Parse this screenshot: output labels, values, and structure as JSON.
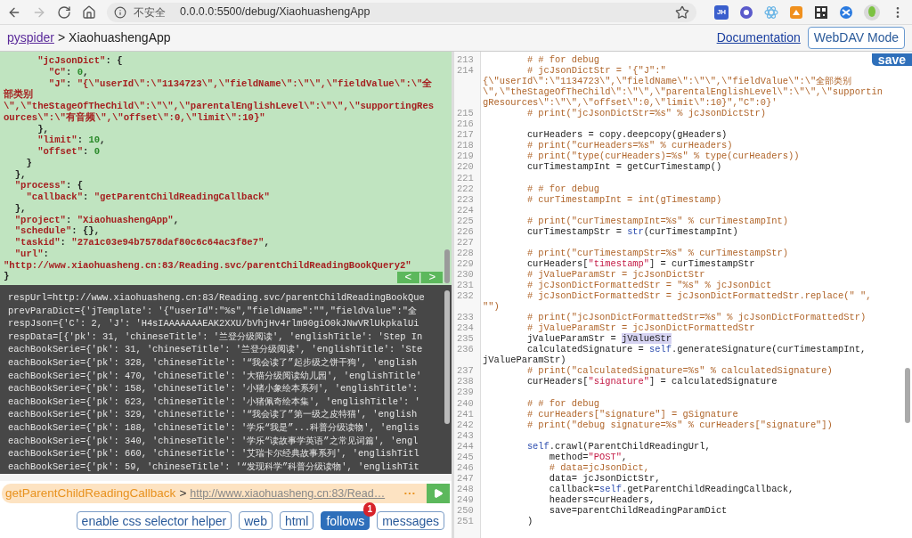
{
  "browser": {
    "forward_disabled": true,
    "security_label": "不安全",
    "url": "0.0.0.0:5500/debug/XiaohuashengApp",
    "extension_label": "JH"
  },
  "header": {
    "root_link": "pyspider",
    "separator": ">",
    "project": "XiaohuashengApp",
    "documentation_link": "Documentation",
    "mode_button": "WebDAV Mode"
  },
  "task_json": {
    "lines": [
      [
        {
          "kind": "string",
          "text": "      \"jcJsonDict\""
        },
        {
          "kind": "punct",
          "text": ": {"
        }
      ],
      [
        {
          "kind": "string",
          "text": "        \"C\""
        },
        {
          "kind": "punct",
          "text": ": "
        },
        {
          "kind": "number",
          "text": "0"
        },
        {
          "kind": "punct",
          "text": ","
        }
      ],
      [
        {
          "kind": "string",
          "text": "        \"J\""
        },
        {
          "kind": "punct",
          "text": ": "
        },
        {
          "kind": "string",
          "text": "\"{\\\"userId\\\":\\\"1134723\\\",\\\"fieldName\\\":\\\"\\\",\\\"fieldValue\\\":\\\"全"
        }
      ],
      [
        {
          "kind": "string",
          "text": "部类别"
        }
      ],
      [
        {
          "kind": "string",
          "text": "\\\",\\\"theStageOfTheChild\\\":\\\"\\\",\\\"parentalEnglishLevel\\\":\\\"\\\",\\\"supportingRes"
        }
      ],
      [
        {
          "kind": "string",
          "text": "ources\\\":\\\"有音频\\\",\\\"offset\\\":0,\\\"limit\\\":10}\""
        }
      ],
      [
        {
          "kind": "punct",
          "text": "      },"
        }
      ],
      [
        {
          "kind": "string",
          "text": "      \"limit\""
        },
        {
          "kind": "punct",
          "text": ": "
        },
        {
          "kind": "number",
          "text": "10"
        },
        {
          "kind": "punct",
          "text": ","
        }
      ],
      [
        {
          "kind": "string",
          "text": "      \"offset\""
        },
        {
          "kind": "punct",
          "text": ": "
        },
        {
          "kind": "number",
          "text": "0"
        }
      ],
      [
        {
          "kind": "punct",
          "text": "    }"
        }
      ],
      [
        {
          "kind": "punct",
          "text": "  },"
        }
      ],
      [
        {
          "kind": "string",
          "text": "  \"process\""
        },
        {
          "kind": "punct",
          "text": ": {"
        }
      ],
      [
        {
          "kind": "string",
          "text": "    \"callback\""
        },
        {
          "kind": "punct",
          "text": ": "
        },
        {
          "kind": "string",
          "text": "\"getParentChildReadingCallback\""
        }
      ],
      [
        {
          "kind": "punct",
          "text": "  },"
        }
      ],
      [
        {
          "kind": "string",
          "text": "  \"project\""
        },
        {
          "kind": "punct",
          "text": ": "
        },
        {
          "kind": "string",
          "text": "\"XiaohuashengApp\""
        },
        {
          "kind": "punct",
          "text": ","
        }
      ],
      [
        {
          "kind": "string",
          "text": "  \"schedule\""
        },
        {
          "kind": "punct",
          "text": ": {},"
        }
      ],
      [
        {
          "kind": "string",
          "text": "  \"taskid\""
        },
        {
          "kind": "punct",
          "text": ": "
        },
        {
          "kind": "string",
          "text": "\"27a1c03e94b7578daf80c6c64ac3f8e7\""
        },
        {
          "kind": "punct",
          "text": ","
        }
      ],
      [
        {
          "kind": "string",
          "text": "  \"url\""
        },
        {
          "kind": "punct",
          "text": ":"
        }
      ],
      [
        {
          "kind": "string",
          "text": "\"http://www.xiaohuasheng.cn:83/Reading.svc/parentChildReadingBookQuery2\""
        }
      ],
      [
        {
          "kind": "punct",
          "text": "}"
        }
      ]
    ],
    "nav_prev": "<",
    "nav_divider": "|",
    "nav_next": ">"
  },
  "log_lines": [
    "respUrl=http://www.xiaohuasheng.cn:83/Reading.svc/parentChildReadingBookQue",
    "prevParaDict={'jTemplate': '{\"userId\":\"%s\",\"fieldName\":\"\",\"fieldValue\":\"全",
    "respJson={'C': 2, 'J': 'H4sIAAAAAAAEAK2XXU/bVhjHv4rlm90giO0kJNwVRlUkpkalUi",
    "respData=[{'pk': 31, 'chineseTitle': '兰登分级阅读', 'englishTitle': 'Step In",
    "eachBookSerie={'pk': 31, 'chineseTitle': '兰登分级阅读', 'englishTitle': 'Ste",
    "eachBookSerie={'pk': 328, 'chineseTitle': '“我会读了”起步级之饼干狗', 'english",
    "eachBookSerie={'pk': 470, 'chineseTitle': '大猫分级阅读幼儿园', 'englishTitle'",
    "eachBookSerie={'pk': 158, 'chineseTitle': '小猪小象绘本系列', 'englishTitle':",
    "eachBookSerie={'pk': 623, 'chineseTitle': '小猪佩奇绘本集', 'englishTitle': '",
    "eachBookSerie={'pk': 329, 'chineseTitle': '“我会读了”第一级之皮特猫', 'english",
    "eachBookSerie={'pk': 188, 'chineseTitle': '学乐“我是”...科普分级读物', 'englis",
    "eachBookSerie={'pk': 340, 'chineseTitle': '学乐“读故事学英语”之常见词篇', 'engl",
    "eachBookSerie={'pk': 660, 'chineseTitle': '艾瑞卡尔经典故事系列', 'englishTitl",
    "eachBookSerie={'pk': 59, 'chineseTitle': '“发现科学”科普分级读物', 'englishTit"
  ],
  "follow_bar": {
    "callback": "getParentChildReadingCallback",
    "separator": ">",
    "url": "http://www.xiaohuasheng.cn:83/Read…",
    "more": "···"
  },
  "tabs": [
    {
      "label": "enable css selector helper",
      "selected": false
    },
    {
      "label": "web",
      "selected": false
    },
    {
      "label": "html",
      "selected": false
    },
    {
      "label": "follows",
      "selected": true,
      "badge": "1"
    },
    {
      "label": "messages",
      "selected": false
    }
  ],
  "editor": {
    "save_button": "save",
    "lines": [
      {
        "number": "213",
        "rows": [
          [
            {
              "kind": "comment",
              "text": "        # # for debug"
            }
          ]
        ]
      },
      {
        "number": "214",
        "rows": [
          [
            {
              "kind": "comment",
              "text": "        # jcJsonDictStr = '{\"J\":\""
            }
          ],
          [
            {
              "kind": "comment",
              "text": "{\\\"userId\\\":\\\"1134723\\\",\\\"fieldName\\\":\\\"\\\",\\\"fieldValue\\\":\\\"全部类别"
            }
          ],
          [
            {
              "kind": "comment",
              "text": "\\\",\\\"theStageOfTheChild\\\":\\\"\\\",\\\"parentalEnglishLevel\\\":\\\"\\\",\\\"supportin"
            }
          ],
          [
            {
              "kind": "comment",
              "text": "gResources\\\":\\\"\\\",\\\"offset\\\":0,\\\"limit\\\":10}\",\"C\":0}'"
            }
          ]
        ]
      },
      {
        "number": "215",
        "rows": [
          [
            {
              "kind": "comment",
              "text": "        # print(\"jcJsonDictStr=%s\" % jcJsonDictStr)"
            }
          ]
        ]
      },
      {
        "number": "216"
      },
      {
        "number": "217",
        "rows": [
          [
            {
              "kind": "plain",
              "text": "        curHeaders = copy.deepcopy(gHeaders)"
            }
          ]
        ]
      },
      {
        "number": "218",
        "rows": [
          [
            {
              "kind": "comment",
              "text": "        # print(\"curHeaders=%s\" % curHeaders)"
            }
          ]
        ]
      },
      {
        "number": "219",
        "rows": [
          [
            {
              "kind": "comment",
              "text": "        # print(\"type(curHeaders)=%s\" % type(curHeaders))"
            }
          ]
        ]
      },
      {
        "number": "220",
        "rows": [
          [
            {
              "kind": "plain",
              "text": "        curTimestampInt = getCurTimestamp()"
            }
          ]
        ]
      },
      {
        "number": "221"
      },
      {
        "number": "222",
        "rows": [
          [
            {
              "kind": "comment",
              "text": "        # # for debug"
            }
          ]
        ]
      },
      {
        "number": "223",
        "rows": [
          [
            {
              "kind": "comment",
              "text": "        # curTimestampInt = int(gTimestamp)"
            }
          ]
        ]
      },
      {
        "number": "224"
      },
      {
        "number": "225",
        "rows": [
          [
            {
              "kind": "comment",
              "text": "        # print(\"curTimestampInt=%s\" % curTimestampInt)"
            }
          ]
        ]
      },
      {
        "number": "226",
        "rows": [
          [
            {
              "kind": "plain",
              "text": "        curTimestampStr = "
            },
            {
              "kind": "builtin",
              "text": "str"
            },
            {
              "kind": "plain",
              "text": "(curTimestampInt)"
            }
          ]
        ]
      },
      {
        "number": "227"
      },
      {
        "number": "228",
        "rows": [
          [
            {
              "kind": "comment",
              "text": "        # print(\"curTimestampStr=%s\" % curTimestampStr)"
            }
          ]
        ]
      },
      {
        "number": "229",
        "rows": [
          [
            {
              "kind": "plain",
              "text": "        curHeaders["
            },
            {
              "kind": "string",
              "text": "\"timestamp\""
            },
            {
              "kind": "plain",
              "text": "] = curTimestampStr"
            }
          ]
        ]
      },
      {
        "number": "230",
        "rows": [
          [
            {
              "kind": "comment",
              "text": "        # jValueParamStr = jcJsonDictStr"
            }
          ]
        ]
      },
      {
        "number": "231",
        "rows": [
          [
            {
              "kind": "comment",
              "text": "        # jcJsonDictFormattedStr = \"%s\" % jcJsonDict"
            }
          ]
        ]
      },
      {
        "number": "232",
        "rows": [
          [
            {
              "kind": "comment",
              "text": "        # jcJsonDictFormattedStr = jcJsonDictFormattedStr.replace(\" \","
            }
          ],
          [
            {
              "kind": "comment",
              "text": "\"\")"
            }
          ]
        ]
      },
      {
        "number": "233",
        "rows": [
          [
            {
              "kind": "comment",
              "text": "        # print(\"jcJsonDictFormattedStr=%s\" % jcJsonDictFormattedStr)"
            }
          ]
        ]
      },
      {
        "number": "234",
        "rows": [
          [
            {
              "kind": "comment",
              "text": "        # jValueParamStr = jcJsonDictFormattedStr"
            }
          ]
        ]
      },
      {
        "number": "235",
        "rows": [
          [
            {
              "kind": "plain",
              "text": "        jValueParamStr = "
            },
            {
              "kind": "highlight",
              "text": "jValueStr"
            }
          ]
        ]
      },
      {
        "number": "236",
        "rows": [
          [
            {
              "kind": "plain",
              "text": "        calculatedSignature = "
            },
            {
              "kind": "builtin",
              "text": "self"
            },
            {
              "kind": "plain",
              "text": ".generateSignature(curTimestampInt,"
            }
          ],
          [
            {
              "kind": "plain",
              "text": "jValueParamStr)"
            }
          ]
        ]
      },
      {
        "number": "237",
        "rows": [
          [
            {
              "kind": "comment",
              "text": "        # print(\"calculatedSignature=%s\" % calculatedSignature)"
            }
          ]
        ]
      },
      {
        "number": "238",
        "rows": [
          [
            {
              "kind": "plain",
              "text": "        curHeaders["
            },
            {
              "kind": "string",
              "text": "\"signature\""
            },
            {
              "kind": "plain",
              "text": "] = calculatedSignature"
            }
          ]
        ]
      },
      {
        "number": "239"
      },
      {
        "number": "240",
        "rows": [
          [
            {
              "kind": "comment",
              "text": "        # # for debug"
            }
          ]
        ]
      },
      {
        "number": "241",
        "rows": [
          [
            {
              "kind": "comment",
              "text": "        # curHeaders[\"signature\"] = gSignature"
            }
          ]
        ]
      },
      {
        "number": "242",
        "rows": [
          [
            {
              "kind": "comment",
              "text": "        # print(\"debug signature=%s\" % curHeaders[\"signature\"])"
            }
          ]
        ]
      },
      {
        "number": "243"
      },
      {
        "number": "244",
        "rows": [
          [
            {
              "kind": "builtin",
              "text": "        self"
            },
            {
              "kind": "plain",
              "text": ".crawl(ParentChildReadingUrl,"
            }
          ]
        ]
      },
      {
        "number": "245",
        "rows": [
          [
            {
              "kind": "plain",
              "text": "            method="
            },
            {
              "kind": "string",
              "text": "\"POST\""
            },
            {
              "kind": "plain",
              "text": ","
            }
          ]
        ]
      },
      {
        "number": "246",
        "rows": [
          [
            {
              "kind": "comment",
              "text": "            # data=jcJsonDict,"
            }
          ]
        ]
      },
      {
        "number": "247",
        "rows": [
          [
            {
              "kind": "plain",
              "text": "            data= jcJsonDictStr,"
            }
          ]
        ]
      },
      {
        "number": "248",
        "rows": [
          [
            {
              "kind": "plain",
              "text": "            callback="
            },
            {
              "kind": "builtin",
              "text": "self"
            },
            {
              "kind": "plain",
              "text": ".getParentChildReadingCallback,"
            }
          ]
        ]
      },
      {
        "number": "249",
        "rows": [
          [
            {
              "kind": "plain",
              "text": "            headers=curHeaders,"
            }
          ]
        ]
      },
      {
        "number": "250",
        "rows": [
          [
            {
              "kind": "plain",
              "text": "            save=parentChildReadingParamDict"
            }
          ]
        ]
      },
      {
        "number": "251",
        "rows": [
          [
            {
              "kind": "plain",
              "text": "        )"
            }
          ]
        ]
      }
    ]
  }
}
